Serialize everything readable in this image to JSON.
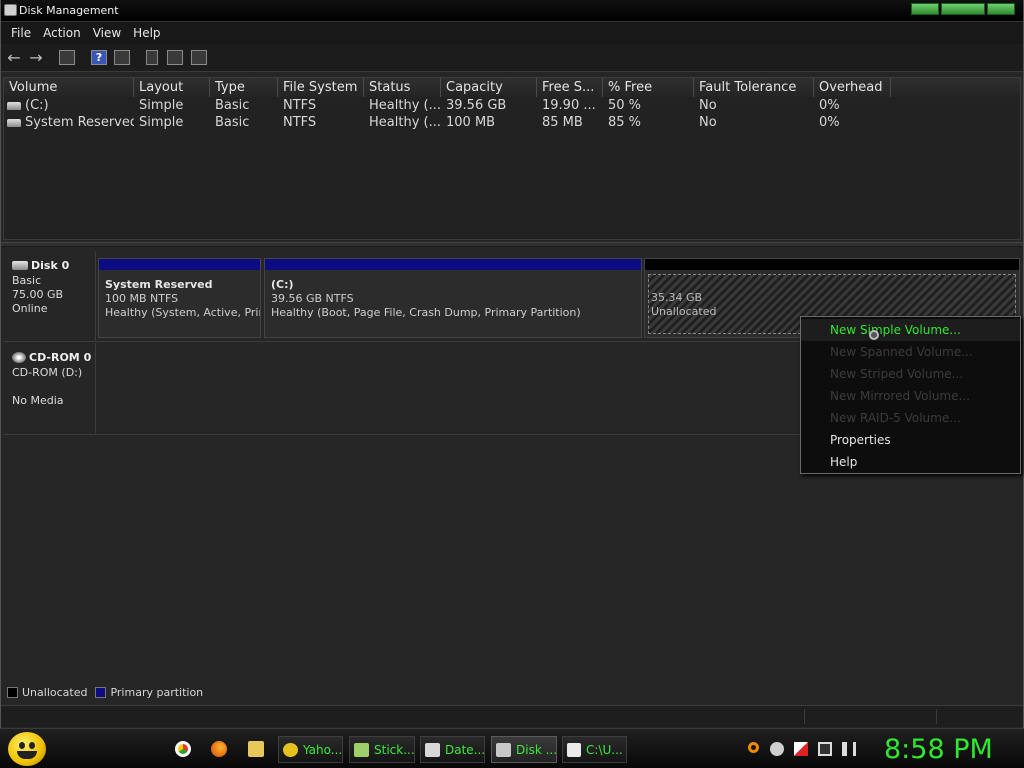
{
  "window": {
    "title": "Disk Management"
  },
  "menu": [
    "File",
    "Action",
    "View",
    "Help"
  ],
  "toolbar": {
    "back_glyph": "←",
    "forward_glyph": "→",
    "help_glyph": "?"
  },
  "volume_list": {
    "columns": [
      "Volume",
      "Layout",
      "Type",
      "File System",
      "Status",
      "Capacity",
      "Free S...",
      "% Free",
      "Fault Tolerance",
      "Overhead"
    ],
    "rows": [
      {
        "volume": "(C:)",
        "layout": "Simple",
        "type": "Basic",
        "fs": "NTFS",
        "status": "Healthy (...",
        "capacity": "39.56 GB",
        "free": "19.90 ...",
        "pct_free": "50 %",
        "fault": "No",
        "overhead": "0%"
      },
      {
        "volume": "System Reserved",
        "layout": "Simple",
        "type": "Basic",
        "fs": "NTFS",
        "status": "Healthy (...",
        "capacity": "100 MB",
        "free": "85 MB",
        "pct_free": "85 %",
        "fault": "No",
        "overhead": "0%"
      }
    ]
  },
  "disks": [
    {
      "name": "Disk 0",
      "kind": "Basic",
      "size": "75.00 GB",
      "state": "Online",
      "partitions": [
        {
          "name": "System Reserved",
          "size": "100 MB NTFS",
          "status": "Healthy (System, Active, Primary Partition)"
        },
        {
          "name": "(C:)",
          "size": "39.56 GB NTFS",
          "status": "Healthy (Boot, Page File, Crash Dump, Primary Partition)"
        },
        {
          "size": "35.34 GB",
          "status": "Unallocated"
        }
      ]
    },
    {
      "name": "CD-ROM 0",
      "kind": "CD-ROM (D:)",
      "state": "No Media"
    }
  ],
  "legend": {
    "unallocated": "Unallocated",
    "primary": "Primary partition"
  },
  "context_menu": {
    "items": [
      "New Simple Volume...",
      "New Spanned Volume...",
      "New Striped Volume...",
      "New Mirrored Volume...",
      "New RAID-5 Volume...",
      "Properties",
      "Help"
    ]
  },
  "taskbar": {
    "tasks": [
      "Yaho...",
      "Stick...",
      "Date...",
      "Disk ...",
      "C:\\U..."
    ],
    "clock": "8:58 PM"
  },
  "colors": {
    "primary_partition": "#0c0c82",
    "accent_green": "#31e831"
  }
}
